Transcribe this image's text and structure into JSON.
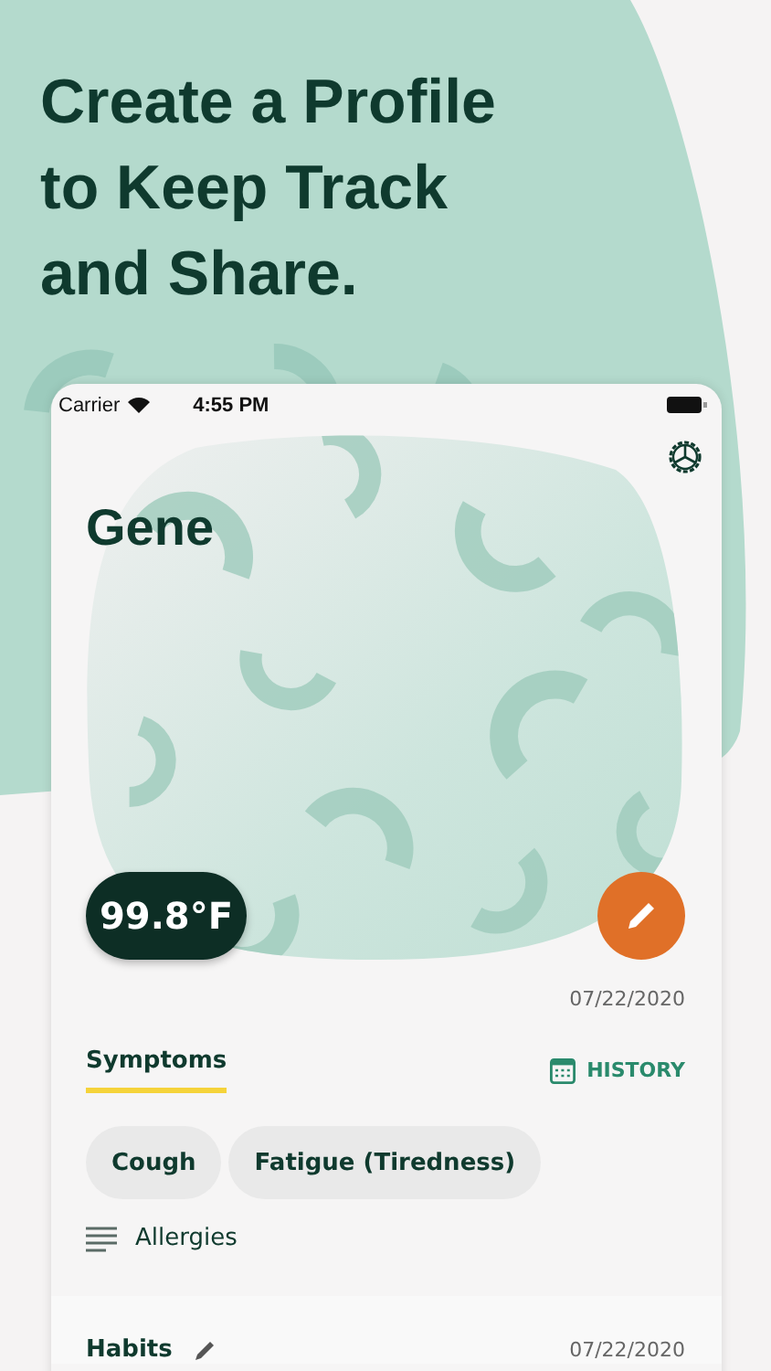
{
  "headline": "Create a Profile to Keep Track and Share.",
  "status_bar": {
    "carrier": "Carrier",
    "time": "4:55 PM"
  },
  "profile": {
    "name": "Gene",
    "temperature": "99.8°F",
    "date": "07/22/2020"
  },
  "symptoms": {
    "tab": {
      "label": "Symptoms",
      "selected": true
    },
    "history": "HISTORY",
    "chips": [
      "Cough",
      "Fatigue (Tiredness)"
    ],
    "note": "Allergies"
  },
  "habits": {
    "title": "Habits",
    "date": "07/22/2020"
  }
}
